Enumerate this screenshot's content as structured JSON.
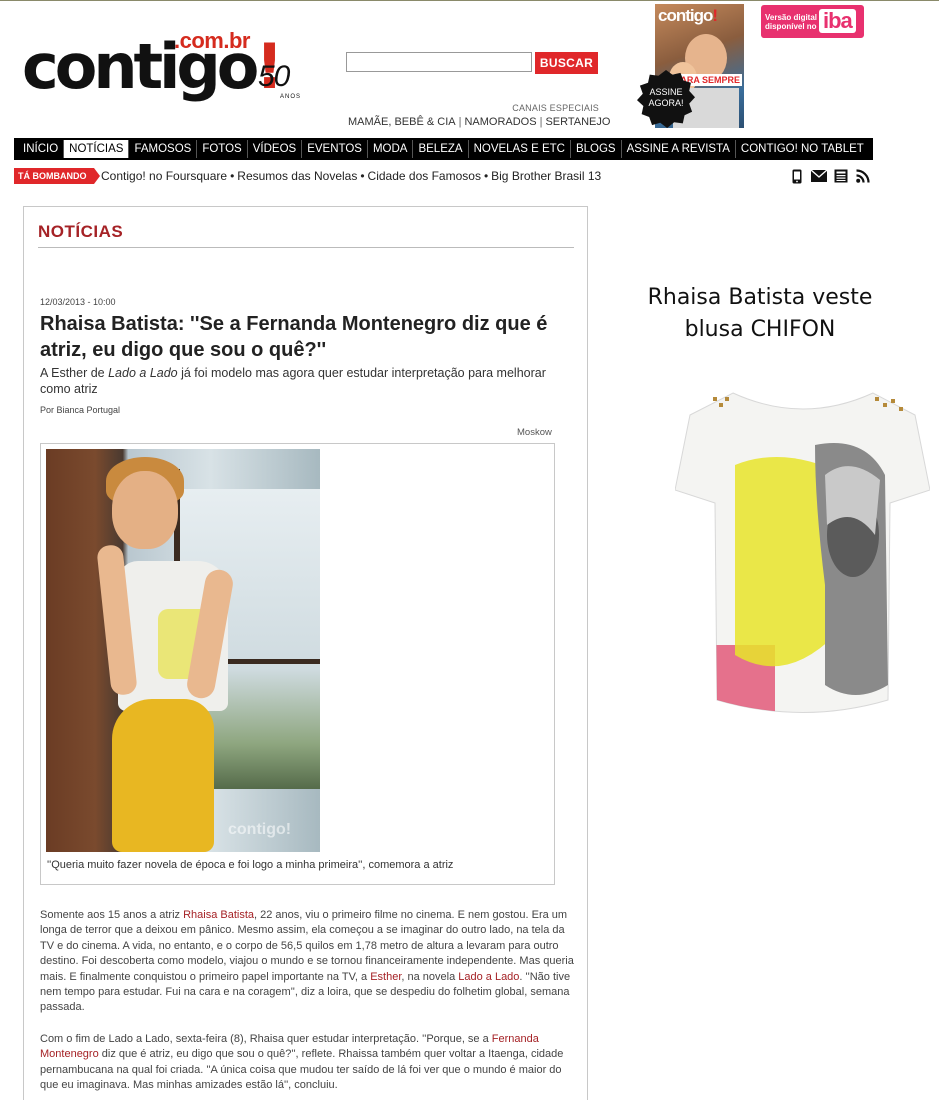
{
  "logo": {
    "main": "contigo",
    "bang": "!",
    "combr": ".com.br",
    "fifty": "50",
    "anos": "ANOS"
  },
  "search": {
    "placeholder": "",
    "button_label": "BUSCAR"
  },
  "canais": {
    "label": "CANAIS ESPECIAIS",
    "links": [
      "MAMÃE, BEBÊ & CIA",
      "NAMORADOS",
      "SERTANEJO"
    ],
    "separator": "|"
  },
  "cover": {
    "title": "contigo",
    "bang": "!",
    "assine": "ASSINE AGORA!",
    "tag": "PARA SEMPRE"
  },
  "iba": {
    "small_line1": "Versão digital",
    "small_line2": "disponível no",
    "brand": "iba"
  },
  "nav": {
    "items": [
      "INÍCIO",
      "NOTÍCIAS",
      "FAMOSOS",
      "FOTOS",
      "VÍDEOS",
      "EVENTOS",
      "MODA",
      "BELEZA",
      "NOVELAS E ETC",
      "BLOGS",
      "ASSINE A REVISTA",
      "CONTIGO! NO TABLET"
    ],
    "active_index": 1
  },
  "trending": {
    "badge": "TÁ BOMBANDO",
    "links": [
      "Contigo! no Foursquare",
      "Resumos das Novelas",
      "Cidade dos Famosos",
      "Big Brother Brasil 13"
    ],
    "separator": "•"
  },
  "social_icons": [
    "mobile-icon",
    "email-icon",
    "newsletter-icon",
    "rss-icon"
  ],
  "article": {
    "section": "NOTÍCIAS",
    "date": "12/03/2013 - 10:00",
    "headline": "Rhaisa Batista: ''Se a Fernanda Montenegro diz que é atriz, eu digo que sou o quê?''",
    "subhead_pre": "A Esther de ",
    "subhead_em": "Lado a Lado",
    "subhead_post": " já foi modelo mas agora quer estudar interpretação para melhorar como atriz",
    "byline": "Por Bianca Portugal",
    "photo_credit": "Moskow",
    "photo_watermark": "contigo!",
    "caption": "''Queria muito fazer novela de época e foi logo a minha primeira'', comemora a atriz",
    "para1": [
      "Somente aos 15 anos a atriz ",
      "Rhaisa Batista",
      ", 22 anos, viu o primeiro filme no cinema. E nem gostou. Era um longa de terror que a deixou em pânico. Mesmo assim, ela começou a se imaginar do outro lado, na tela da TV e do cinema. A vida, no entanto, e o corpo de 56,5 quilos em 1,78 metro de altura a levaram para outro destino. Foi descoberta como modelo, viajou o mundo e se tornou financeiramente independente. Mas queria mais. E finalmente conquistou o primeiro papel importante na TV, a ",
      "Esther",
      ", na novela ",
      "Lado a Lado",
      ". ''Não tive nem tempo para estudar. Fui na cara e na coragem'', diz a loira, que se despediu do folhetim global, semana passada."
    ],
    "para2": [
      "Com o fim de Lado a Lado, sexta-feira (8), Rhaisa quer estudar interpretação. ''Porque, se a ",
      "Fernanda Montenegro",
      " diz que é atriz, eu digo que sou o quê?'', reflete. Rhaissa também quer voltar a Itaenga, cidade pernambucana na qual foi criada. ''A única coisa que mudou ter saído de lá foi ver que o mundo é maior do que eu imaginava. Mas minhas amizades estão lá'', concluiu."
    ]
  },
  "ad": {
    "line1": "Rhaisa Batista veste",
    "line2": "blusa CHIFON"
  },
  "colors": {
    "accent": "#e0272a",
    "link": "#a52226",
    "nav_bg": "#000000",
    "iba": "#e8316f"
  }
}
